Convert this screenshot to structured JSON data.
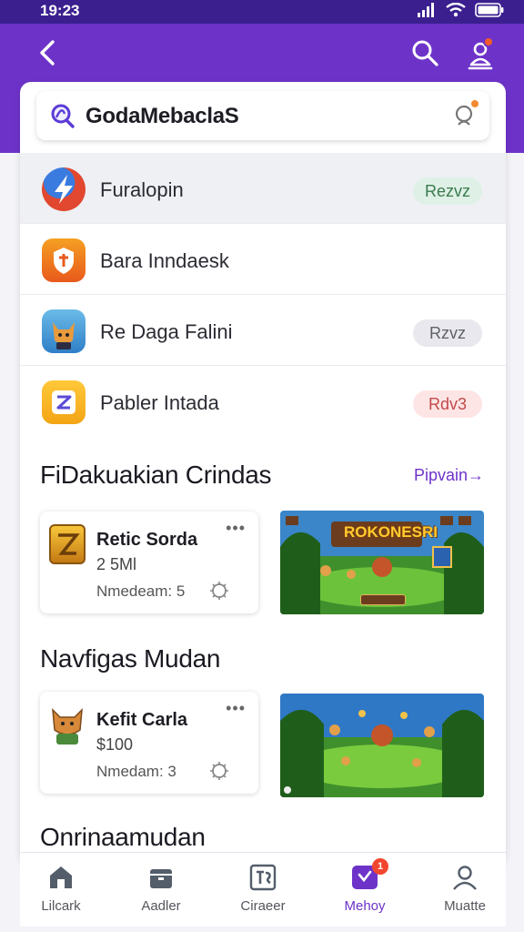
{
  "status": {
    "time": "19:23"
  },
  "search": {
    "query": "GodaMebaclaS"
  },
  "list": [
    {
      "label": "Furalopin",
      "badge": "Rezvz",
      "badge_bg": "#dff1e6",
      "badge_fg": "#3b7a4f",
      "icon": "lightning-app-icon"
    },
    {
      "label": "Bara Inndaesk",
      "badge": "",
      "icon": "shield-app-icon"
    },
    {
      "label": "Re Daga Falini",
      "badge": "Rzvz",
      "badge_bg": "#e8e8ee",
      "badge_fg": "#60606a",
      "icon": "fox-app-icon"
    },
    {
      "label": "Pabler Intada",
      "badge": "Rdv3",
      "badge_bg": "#fde5e5",
      "badge_fg": "#c24a4a",
      "icon": "z-app-icon"
    }
  ],
  "sections": [
    {
      "title": "FiDakuakian Crindas",
      "see_all": "Pipvain→",
      "card": {
        "title": "Retic Sorda",
        "number": "2 5Ml",
        "meta": "Nmedeam: 5",
        "more": "•••"
      },
      "game_banner": "ROKONESRI"
    },
    {
      "title": "Navfigas Mudan",
      "see_all": "",
      "card": {
        "title": "Kefit Carla",
        "number": "$100",
        "meta": "Nmedam: 3",
        "more": "•••"
      },
      "game_banner": ""
    }
  ],
  "partial_title": "Onrinaamudan",
  "tabs": [
    {
      "label": "Lilcark",
      "icon": "home-icon"
    },
    {
      "label": "Aadler",
      "icon": "box-icon"
    },
    {
      "label": "Ciraeer",
      "icon": "ts-icon"
    },
    {
      "label": "Mehoy",
      "icon": "chat-icon",
      "badge": "1"
    },
    {
      "label": "Muatte",
      "icon": "person-icon"
    }
  ],
  "colors": {
    "primary": "#6d33c9",
    "status_bar": "#3b1f8f",
    "badge_dot": "#f25a2b"
  }
}
